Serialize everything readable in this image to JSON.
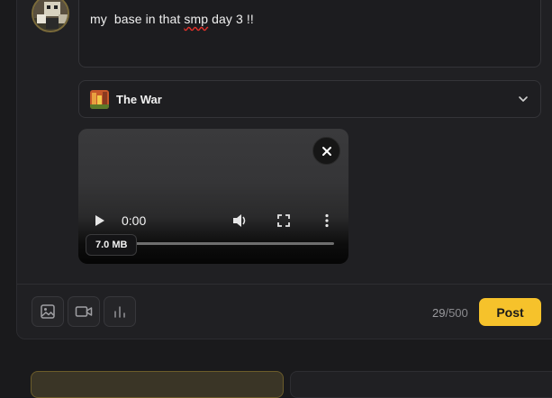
{
  "composer": {
    "text": "my  base in that smp day 3 !!",
    "misspelled_word": "smp"
  },
  "community_select": {
    "label": "The War",
    "icon": "chevron-down-icon"
  },
  "video": {
    "time": "0:00",
    "size": "7.0 MB",
    "progress": 0
  },
  "toolbar": {
    "image_icon": "image-icon",
    "video_icon": "video-icon",
    "poll_icon": "bar-chart-icon",
    "char_count": "29",
    "char_limit": "/500",
    "post_label": "Post"
  },
  "colors": {
    "accent": "#f6c22b",
    "background": "#1a1a1c",
    "panel": "#202023"
  }
}
